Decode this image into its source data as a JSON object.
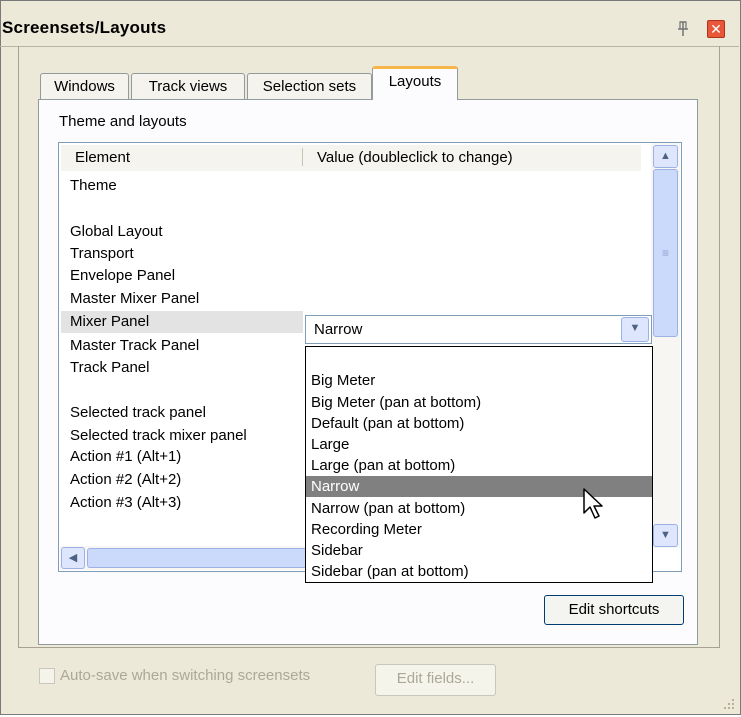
{
  "window": {
    "title": "Screensets/Layouts"
  },
  "tabs": [
    {
      "label": "Windows",
      "active": false
    },
    {
      "label": "Track views",
      "active": false
    },
    {
      "label": "Selection sets",
      "active": false
    },
    {
      "label": "Layouts",
      "active": true
    }
  ],
  "section_label": "Theme and layouts",
  "list": {
    "columns": [
      "Element",
      "Value (doubleclick to change)"
    ],
    "rows": [
      "Theme",
      "",
      "Global Layout",
      "Transport",
      "Envelope Panel",
      "Master Mixer Panel",
      "Mixer Panel",
      "Master Track Panel",
      "Track Panel",
      "",
      "Selected track panel",
      "Selected track mixer panel",
      "",
      "Action #1 (Alt+1)",
      "Action #2 (Alt+2)",
      "Action #3 (Alt+3)"
    ],
    "selected_row": "Mixer Panel"
  },
  "combo": {
    "value": "Narrow",
    "options": [
      "",
      "Big Meter",
      "Big Meter (pan at bottom)",
      "Default (pan at bottom)",
      "Large",
      "Large (pan at bottom)",
      "Narrow",
      "Narrow (pan at bottom)",
      "Recording Meter",
      "Sidebar",
      "Sidebar (pan at bottom)"
    ],
    "highlighted": "Narrow"
  },
  "buttons": {
    "edit_shortcuts": "Edit shortcuts",
    "edit_fields": "Edit fields..."
  },
  "autosave": {
    "label": "Auto-save when switching screensets",
    "checked": false,
    "enabled": false
  },
  "icons": {
    "pin": "pin-icon",
    "close": "close-icon",
    "scroll_up": "arrow-up-icon",
    "scroll_down": "arrow-down-icon",
    "scroll_left": "arrow-left-icon",
    "combo_arrow": "chevron-down-icon",
    "cursor": "mouse-pointer-icon",
    "grip": "resize-grip-icon"
  },
  "colors": {
    "close": "#e9573a",
    "tab_accent": "#f7b64a",
    "highlight": "#808080",
    "scroll": "#cbd9fb"
  }
}
